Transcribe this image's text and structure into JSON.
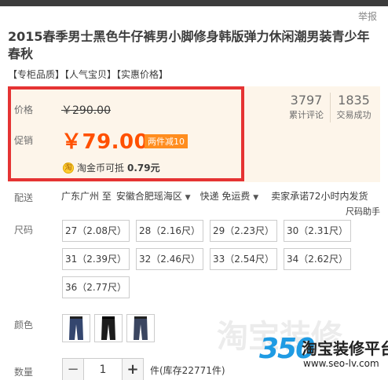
{
  "header": {
    "report_label": "举报"
  },
  "product": {
    "title": "2015春季男士黑色牛仔裤男小脚修身韩版弹力休闲潮男装青少年春秋",
    "tags": "【专柜品质】【人气宝贝】【实惠价格】"
  },
  "pricing": {
    "price_label": "价格",
    "original_price": "￥290.00",
    "promo_label": "促销",
    "promo_price": "￥79.00",
    "promo_badge": "两件减10",
    "coin_icon": "淘",
    "coin_text_prefix": "淘金币可抵",
    "coin_amount": "0.79元"
  },
  "stats": [
    {
      "value": "3797",
      "label": "累计评论"
    },
    {
      "value": "1835",
      "label": "交易成功"
    }
  ],
  "delivery": {
    "label": "配送",
    "from": "广东广州 至",
    "destination": "安徽合肥瑶海区",
    "shipping": "快递 免运费",
    "promise": "卖家承诺72小时内发货",
    "size_help": "尺码助手"
  },
  "size": {
    "label": "尺码",
    "options": [
      "27（2.08尺）",
      "28（2.16尺）",
      "29（2.23尺）",
      "30（2.31尺）",
      "31（2.39尺）",
      "32（2.46尺）",
      "33（2.54尺）",
      "34（2.62尺）",
      "36（2.77尺）"
    ]
  },
  "color": {
    "label": "颜色",
    "swatches": [
      "jeans-blue-icon",
      "jeans-black-icon",
      "jeans-darkblue-icon"
    ],
    "swatch_colors": [
      "#34466e",
      "#1c1c1c",
      "#3a4560"
    ]
  },
  "quantity": {
    "label": "数量",
    "minus": "−",
    "value": "1",
    "plus": "+",
    "stock": "件(库存22771件)"
  },
  "brand": {
    "watermark": "淘宝装修",
    "logo_number": "350",
    "logo_name": "淘宝装修平台",
    "logo_url": "www.seo-lv.com"
  },
  "colors": {
    "accent": "#ff5000",
    "frame": "#e53333",
    "panel": "#fdf5ea",
    "badge": "#ff8d1f"
  }
}
